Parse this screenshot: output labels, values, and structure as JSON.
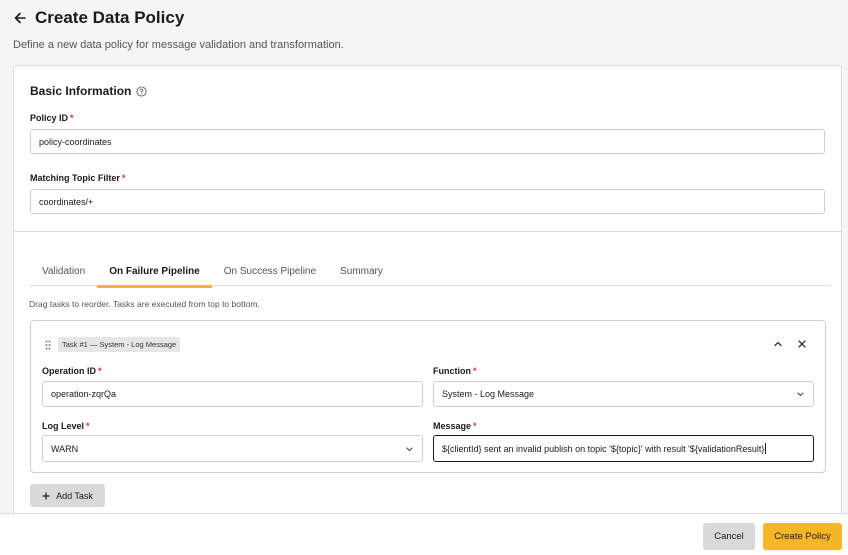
{
  "header": {
    "title": "Create Data Policy",
    "subtitle": "Define a new data policy for message validation and transformation."
  },
  "basic_info": {
    "title": "Basic Information",
    "policy_id_label": "Policy ID",
    "policy_id_value": "policy-coordinates",
    "topic_filter_label": "Matching Topic Filter",
    "topic_filter_value": "coordinates/+",
    "required_mark": "*"
  },
  "tabs": [
    {
      "label": "Validation",
      "active": false
    },
    {
      "label": "On Failure Pipeline",
      "active": true
    },
    {
      "label": "On Success Pipeline",
      "active": false
    },
    {
      "label": "Summary",
      "active": false
    }
  ],
  "pipeline": {
    "hint": "Drag tasks to reorder. Tasks are executed from top to bottom.",
    "task": {
      "tag": "Task #1 — System - Log Message",
      "operation_id_label": "Operation ID",
      "operation_id_value": "operation-zqrQa",
      "function_label": "Function",
      "function_value": "System - Log Message",
      "log_level_label": "Log Level",
      "log_level_value": "WARN",
      "message_label": "Message",
      "message_value": "${clientId} sent an invalid publish on topic '${topic}' with result '${validationResult}"
    },
    "add_task_label": "Add Task"
  },
  "footer": {
    "cancel_label": "Cancel",
    "create_label": "Create Policy"
  },
  "colors": {
    "accent": "#f6b625",
    "required": "#d93025"
  },
  "icons": [
    "arrow-left-icon",
    "help-circle-icon",
    "drag-handle-icon",
    "chevron-up-icon",
    "close-icon",
    "chevron-down-icon",
    "plus-icon"
  ]
}
